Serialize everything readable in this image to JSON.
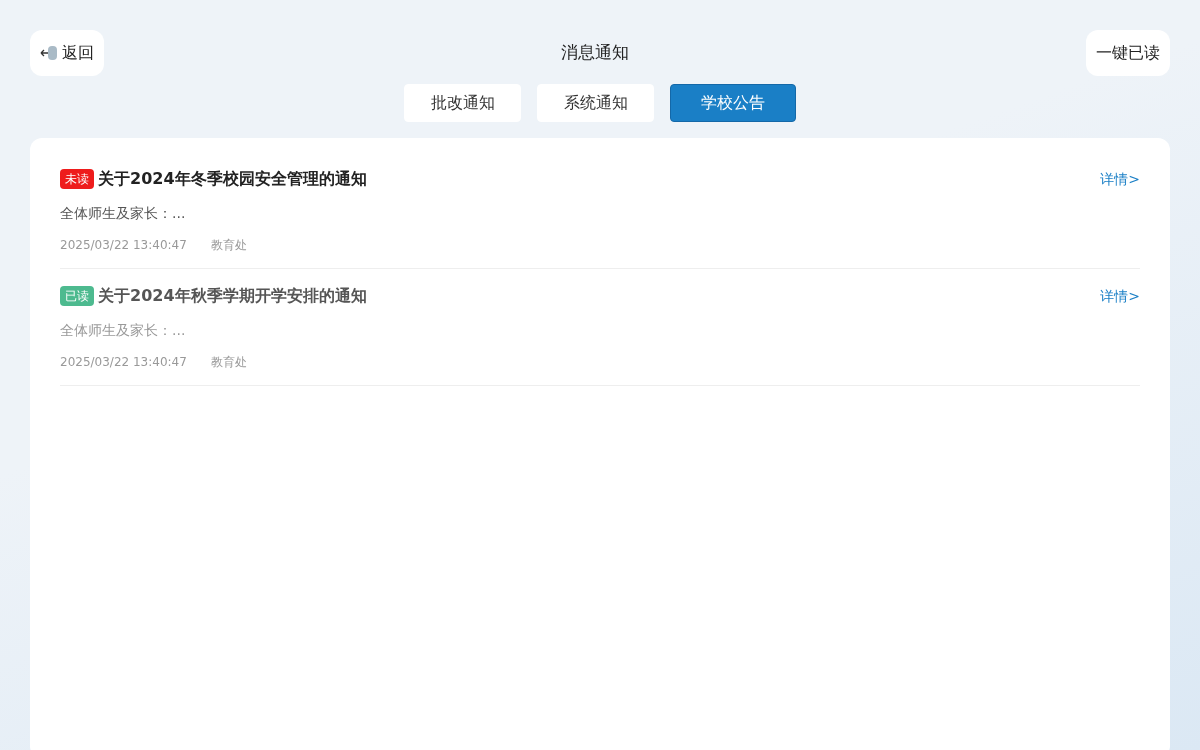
{
  "header": {
    "back_label": "返回",
    "title": "消息通知",
    "mark_all_label": "一键已读"
  },
  "tabs": [
    {
      "label": "批改通知",
      "selected": false
    },
    {
      "label": "系统通知",
      "selected": false
    },
    {
      "label": "学校公告",
      "selected": true
    }
  ],
  "notices": [
    {
      "badge": "未读",
      "read": false,
      "title": "关于2024年冬季校园安全管理的通知",
      "excerpt": "全体师生及家长：...",
      "time": "2025/03/22 13:40:47",
      "source": "教育处",
      "link": "详情>"
    },
    {
      "badge": "已读",
      "read": true,
      "title": "关于2024年秋季学期开学安排的通知",
      "excerpt": "全体师生及家长：...",
      "time": "2025/03/22 13:40:47",
      "source": "教育处",
      "link": "详情>"
    }
  ]
}
